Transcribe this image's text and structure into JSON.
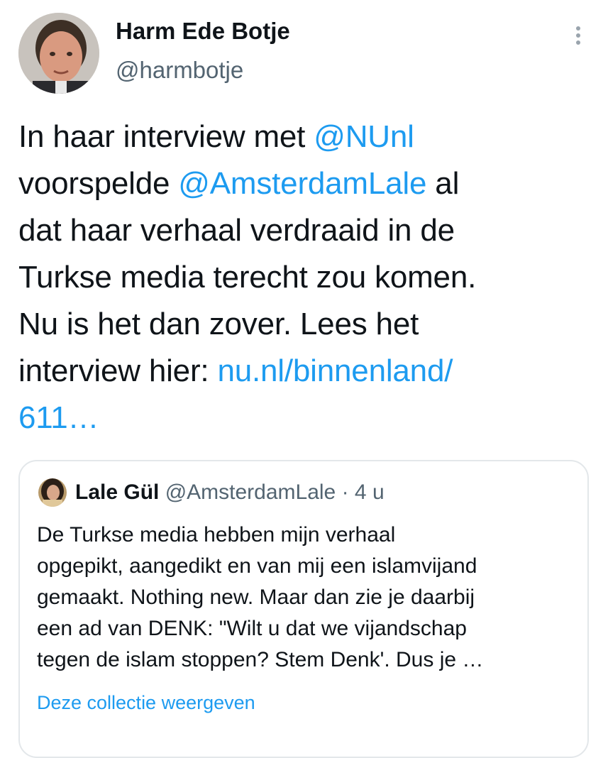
{
  "author": {
    "name": "Harm Ede Botje",
    "handle": "@harmbotje"
  },
  "tweet": {
    "lines": [
      [
        {
          "text": "In haar interview met ",
          "link": false
        },
        {
          "text": "@NUnl",
          "link": true
        }
      ],
      [
        {
          "text": "voorspelde ",
          "link": false
        },
        {
          "text": "@AmsterdamLale",
          "link": true
        },
        {
          "text": " al",
          "link": false
        }
      ],
      [
        {
          "text": "dat haar verhaal verdraaid in de",
          "link": false
        }
      ],
      [
        {
          "text": "Turkse media terecht zou komen.",
          "link": false
        }
      ],
      [
        {
          "text": "Nu is het dan zover. Lees het",
          "link": false
        }
      ],
      [
        {
          "text": "interview hier: ",
          "link": false
        },
        {
          "text": "nu.nl/binnenland/",
          "link": true
        }
      ],
      [
        {
          "text": "611…",
          "link": true
        }
      ]
    ]
  },
  "quote": {
    "name": "Lale Gül",
    "handle": "@AmsterdamLale",
    "separator": " · ",
    "time": "4 u",
    "lines": [
      "De Turkse media hebben mijn verhaal",
      "opgepikt, aangedikt en van mij een islamvijand",
      "gemaakt. Nothing new. Maar dan zie je daarbij",
      "een ad van DENK: \"Wilt u dat we vijandschap",
      "tegen de islam stoppen? Stem Denk'. Dus je …"
    ],
    "collection_link": "Deze collectie weergeven"
  },
  "icons": {
    "more": "more-vertical-icon"
  },
  "colors": {
    "link": "#1d9bf0",
    "secondary_text": "#536471",
    "primary_text": "#0f1419",
    "border": "#e3e7ea"
  }
}
